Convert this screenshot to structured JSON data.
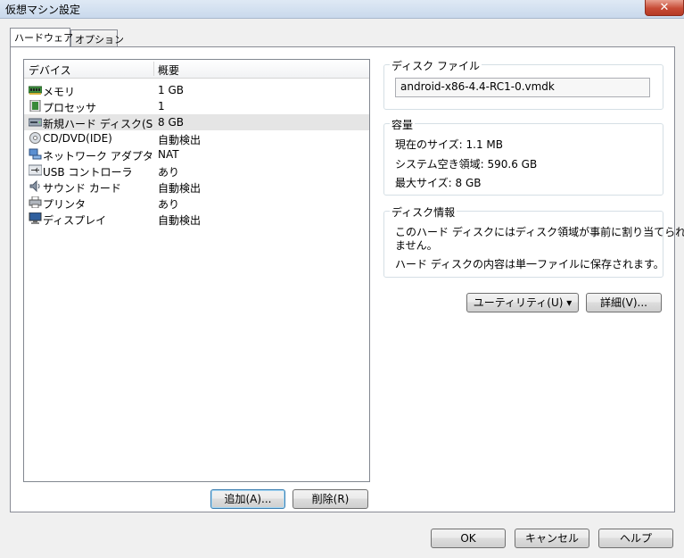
{
  "window": {
    "title": "仮想マシン設定",
    "close_label": "✕"
  },
  "tabs": [
    {
      "label": "ハードウェア",
      "active": true
    },
    {
      "label": "オプション",
      "active": false
    }
  ],
  "devices": {
    "columns": [
      "デバイス",
      "概要"
    ],
    "rows": [
      {
        "name": "メモリ",
        "summary": "1 GB",
        "icon": "memory-icon"
      },
      {
        "name": "プロセッサ",
        "summary": "1",
        "icon": "processor-icon"
      },
      {
        "name": "新規ハード ディスク(S...",
        "summary": "8 GB",
        "icon": "hard-disk-icon",
        "selected": true
      },
      {
        "name": "CD/DVD(IDE)",
        "summary": "自動検出",
        "icon": "cd-dvd-icon"
      },
      {
        "name": "ネットワーク アダプタ",
        "summary": "NAT",
        "icon": "network-adapter-icon"
      },
      {
        "name": "USB コントローラ",
        "summary": "あり",
        "icon": "usb-icon"
      },
      {
        "name": "サウンド カード",
        "summary": "自動検出",
        "icon": "sound-card-icon"
      },
      {
        "name": "プリンタ",
        "summary": "あり",
        "icon": "printer-icon"
      },
      {
        "name": "ディスプレイ",
        "summary": "自動検出",
        "icon": "display-icon"
      }
    ],
    "add_label": "追加(A)...",
    "remove_label": "削除(R)"
  },
  "disk_file": {
    "legend": "ディスク ファイル",
    "value": "android-x86-4.4-RC1-0.vmdk"
  },
  "capacity": {
    "legend": "容量",
    "current_size": "現在のサイズ: 1.1 MB",
    "free_space": "システム空き領域: 590.6 GB",
    "max_size": "最大サイズ: 8 GB"
  },
  "disk_info": {
    "legend": "ディスク情報",
    "line1": "このハード ディスクにはディスク領域が事前に割り当てられてい",
    "line2": "ません。",
    "line3": "ハード ディスクの内容は単一ファイルに保存されます。"
  },
  "actions": {
    "utility_label": "ユーティリティ(U) ▾",
    "details_label": "詳細(V)..."
  },
  "footer": {
    "ok_label": "OK",
    "cancel_label": "キャンセル",
    "help_label": "ヘルプ"
  }
}
